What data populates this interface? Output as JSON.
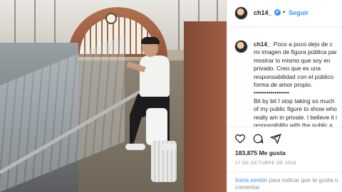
{
  "post": {
    "username": "ch14_",
    "verified_mark": "✔",
    "separator": "•",
    "follow_label": "Seguir",
    "caption_spanish": "Poco a poco dejo de c\nmi imagen de figura pública par\nmostrar lo mismo que soy en\nprivado. Creo que es una\nresponsabilidad con el público\nforma de amor propio.\n•••••••••••••••••",
    "caption_english": "Bit by bit I stop taking so much\nof my public figure to show who\nreally am in private. I believe it i\nresponsibility with the public a",
    "likes": "183,875 Me gusta",
    "date": "17 DE OCTUBRE DE 2018",
    "login_link": "Inicia sesión",
    "login_rest": " para indicar que te gusta o\ncomentar."
  },
  "icons": {
    "like": "heart-icon",
    "comment": "comment-icon",
    "share": "share-icon",
    "avatar": "avatar"
  },
  "colors": {
    "accent_blue": "#3897f0",
    "text": "#262626",
    "muted": "#8e8e8e",
    "border": "#efefef"
  }
}
